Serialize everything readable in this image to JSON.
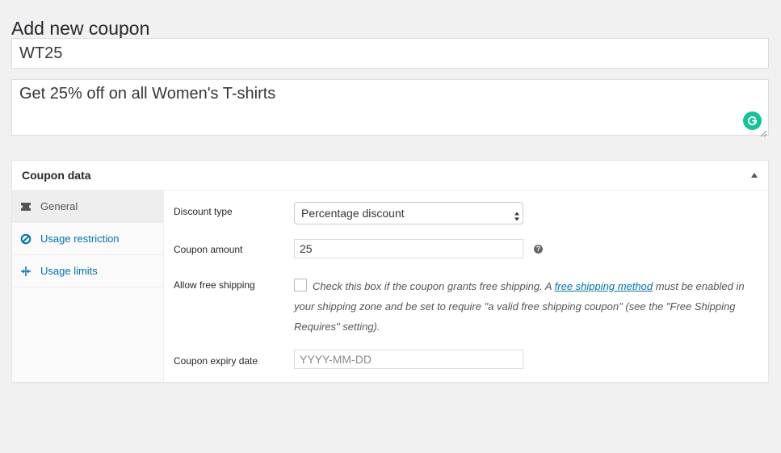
{
  "page": {
    "title": "Add new coupon"
  },
  "coupon_code": {
    "value": "WT25"
  },
  "description": {
    "value": "Get 25% off on all Women's T-shirts"
  },
  "coupon_data": {
    "title": "Coupon data",
    "tabs": [
      {
        "label": "General",
        "icon": "ticket-icon",
        "active": true
      },
      {
        "label": "Usage restriction",
        "icon": "restriction-icon",
        "active": false
      },
      {
        "label": "Usage limits",
        "icon": "limits-icon",
        "active": false
      }
    ],
    "general": {
      "discount_type": {
        "label": "Discount type",
        "selected": "Percentage discount"
      },
      "coupon_amount": {
        "label": "Coupon amount",
        "value": "25"
      },
      "free_shipping": {
        "label": "Allow free shipping",
        "checked": false,
        "desc_before": "Check this box if the coupon grants free shipping. A ",
        "link_text": "free shipping method",
        "desc_after": " must be enabled in your shipping zone and be set to require \"a valid free shipping coupon\" (see the \"Free Shipping Requires\" setting)."
      },
      "expiry_date": {
        "label": "Coupon expiry date",
        "placeholder": "YYYY-MM-DD"
      }
    }
  },
  "colors": {
    "accent": "#0073aa",
    "grammarly": "#15c39a",
    "background": "#f1f1f1"
  }
}
